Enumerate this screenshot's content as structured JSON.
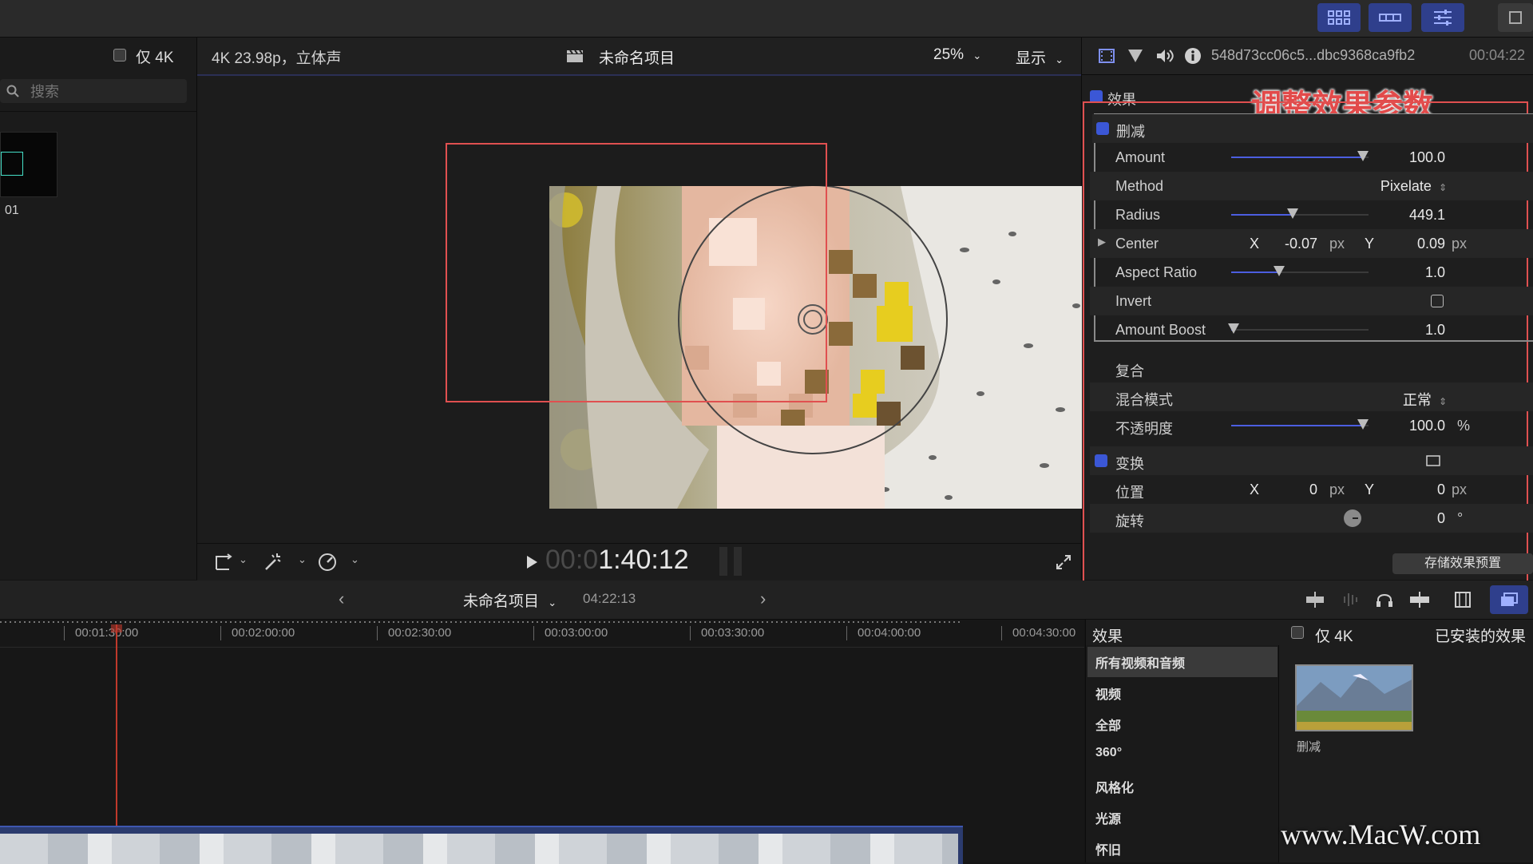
{
  "topbar": {
    "buttons": [
      "browser-icon",
      "timeline-icon",
      "inspector-icon"
    ]
  },
  "browser": {
    "only4k_label": "仅 4K",
    "search_placeholder": "搜索",
    "clip_label": "01"
  },
  "viewer": {
    "format": "4K 23.98p，立体声",
    "project_title": "未命名项目",
    "zoom": "25%",
    "display_label": "显示",
    "timecode_dim": "00:0",
    "timecode_bright": "1:40:12"
  },
  "inspector": {
    "clip_name": "548d73cc06c5...dbc9368ca9fb2",
    "clip_duration": "00:04:22",
    "annotation": "调整效果参数",
    "effects_section": "效果",
    "effect_name": "删减",
    "params": {
      "amount_label": "Amount",
      "amount_value": "100.0",
      "amount": 0.96,
      "method_label": "Method",
      "method_value": "Pixelate",
      "radius_label": "Radius",
      "radius_value": "449.1",
      "radius": 0.45,
      "center_label": "Center",
      "center_x_label": "X",
      "center_x": "-0.07",
      "center_y_label": "Y",
      "center_y": "0.09",
      "unit_px": "px",
      "aspect_label": "Aspect Ratio",
      "aspect_value": "1.0",
      "aspect": 0.35,
      "invert_label": "Invert",
      "boost_label": "Amount Boost",
      "boost_value": "1.0",
      "boost": 0.02
    },
    "composite_section": "复合",
    "blend_label": "混合模式",
    "blend_value": "正常",
    "opacity_label": "不透明度",
    "opacity_value": "100.0",
    "opacity_unit": "%",
    "opacity": 0.96,
    "transform_section": "变换",
    "position_label": "位置",
    "position_x_label": "X",
    "position_x": "0",
    "position_y_label": "Y",
    "position_y": "0",
    "rotation_label": "旋转",
    "rotation_value": "0",
    "rotation_unit": "°",
    "save_preset_label": "存储效果预置"
  },
  "timeline": {
    "project_title": "未命名项目",
    "duration": "04:22:13",
    "ruler_labels": [
      "00:01:30:00",
      "00:02:00:00",
      "00:02:30:00",
      "00:03:00:00",
      "00:03:30:00",
      "00:04:00:00",
      "00:04:30:00"
    ]
  },
  "effects_browser": {
    "title": "效果",
    "only4k_label": "仅 4K",
    "installed_label": "已安装的效果",
    "categories": [
      "所有视频和音频",
      "视频",
      "全部",
      "360°",
      "风格化",
      "光源",
      "怀旧"
    ],
    "effect_thumb_label": "删减"
  },
  "watermark": "www.MacW.com",
  "colors": {
    "accent": "#3b57d6",
    "annotation_red": "#e05050",
    "playhead": "#c0392b"
  }
}
